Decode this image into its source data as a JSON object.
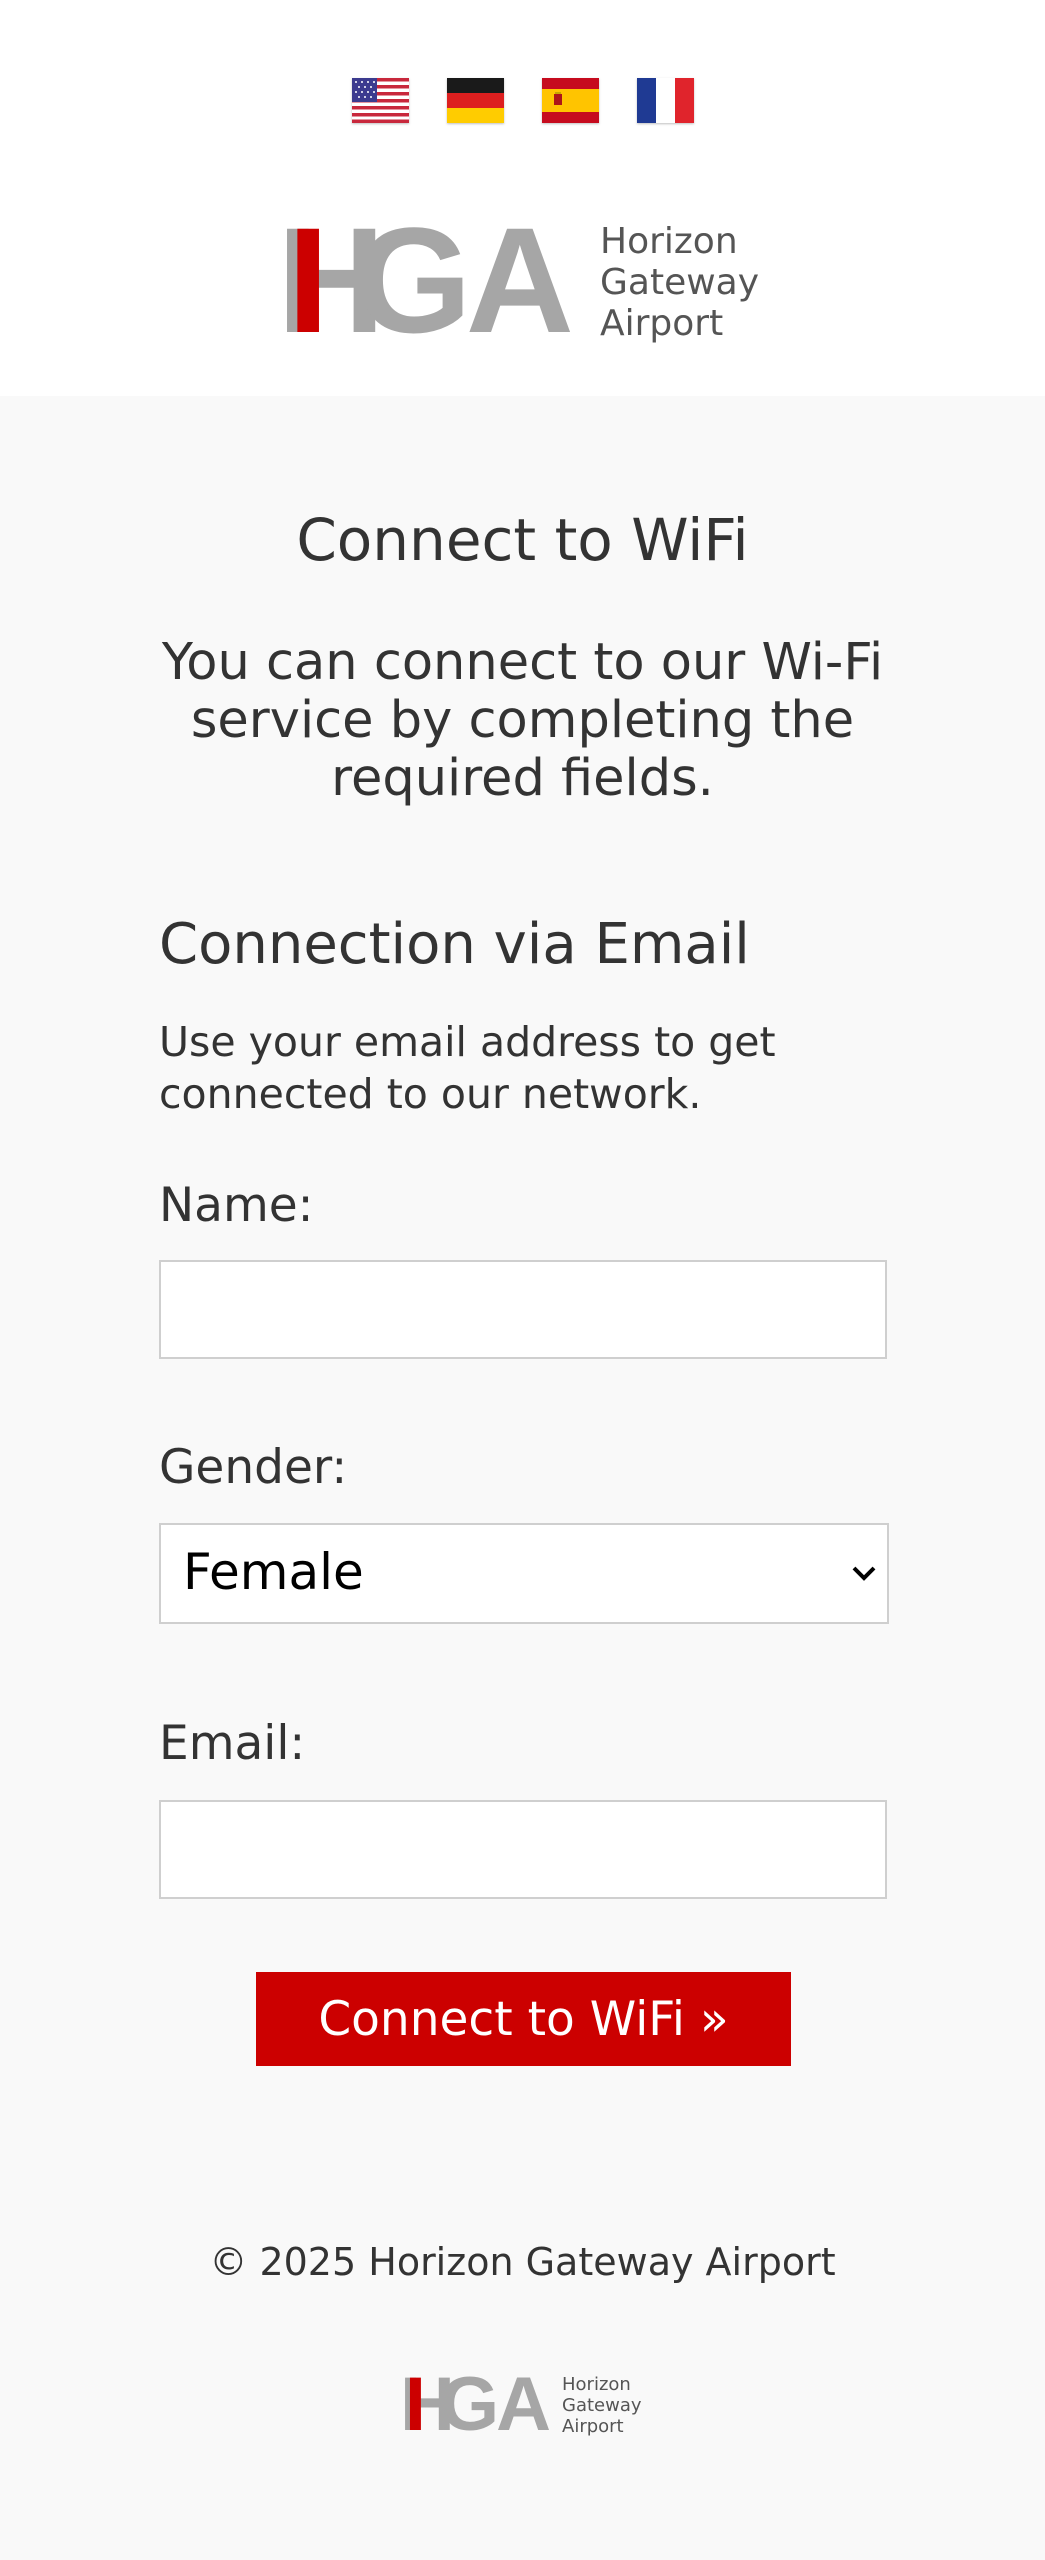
{
  "header": {
    "languages": [
      {
        "code": "en",
        "name": "English (US)"
      },
      {
        "code": "de",
        "name": "Deutsch"
      },
      {
        "code": "es",
        "name": "Español"
      },
      {
        "code": "fr",
        "name": "Français"
      }
    ],
    "logo": {
      "initials": "HGA",
      "line1": "Horizon",
      "line2": "Gateway",
      "line3": "Airport"
    }
  },
  "main": {
    "title": "Connect to WiFi",
    "intro": "You can connect to our Wi-Fi service by completing the required fields.",
    "section_title": "Connection via Email",
    "section_desc": "Use your email address to get connected to our network.",
    "form": {
      "name_label": "Name:",
      "name_value": "",
      "gender_label": "Gender:",
      "gender_selected": "Female",
      "email_label": "Email:",
      "email_value": "",
      "submit_label": "Connect to WiFi »"
    }
  },
  "footer": {
    "copyright": "© 2025 Horizon Gateway Airport",
    "logo": {
      "initials": "HGA",
      "line1": "Horizon",
      "line2": "Gateway",
      "line3": "Airport"
    }
  },
  "colors": {
    "accent": "#cc0000",
    "logo_gray": "#a6a6a6",
    "logo_text": "#555555",
    "text": "#333333",
    "background": "#f9f9f9"
  }
}
